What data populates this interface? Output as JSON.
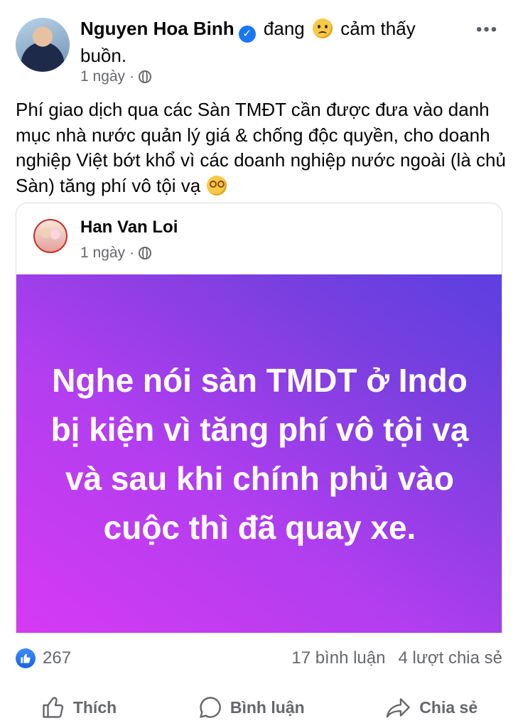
{
  "post": {
    "author": "Nguyen Hoa Binh",
    "feeling_prefix": "đang",
    "feeling_text": "cảm thấy buồn.",
    "time": "1 ngày",
    "more_label": "•••",
    "body_text": "Phí giao dịch qua các Sàn TMĐT cần được đưa vào danh mục nhà nước quản lý giá & chống độc quyền, cho doanh nghiệp Việt bớt khổ vì các doanh nghiệp nước ngoài (là chủ Sàn) tăng phí vô tội vạ"
  },
  "shared_post": {
    "author": "Han Van Loi",
    "time": "1 ngày",
    "text": "Nghe nói sàn TMDT ở Indo bị kiện vì tăng phí vô tội vạ và sau khi chính phủ vào cuộc thì đã quay xe.",
    "gradient_colors": [
      "#d63af2",
      "#5b3fe0"
    ]
  },
  "engagement": {
    "reaction_count": "267",
    "comments": "17 bình luận",
    "shares": "4 lượt chia sẻ"
  },
  "actions": {
    "like": "Thích",
    "comment": "Bình luận",
    "share": "Chia sẻ"
  },
  "colors": {
    "accent": "#1877f2",
    "muted_text": "#65676b"
  }
}
